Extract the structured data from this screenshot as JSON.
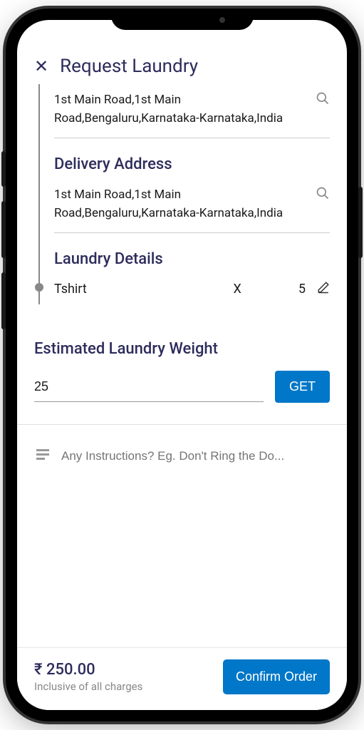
{
  "header": {
    "close": "✕",
    "title": "Request Laundry"
  },
  "pickup": {
    "address": "1st Main Road,1st Main Road,Bengaluru,Karnataka-Karnataka,India"
  },
  "delivery": {
    "title": "Delivery Address",
    "address": "1st Main Road,1st Main Road,Bengaluru,Karnataka-Karnataka,India"
  },
  "laundry": {
    "title": "Laundry Details",
    "item_name": "Tshirt",
    "item_x": "X",
    "item_qty": "5"
  },
  "weight": {
    "title": "Estimated Laundry Weight",
    "value": "25",
    "button": "GET"
  },
  "instructions": {
    "placeholder": "Any Instructions? Eg. Don't Ring the Do..."
  },
  "footer": {
    "price": "₹ 250.00",
    "sub": "Inclusive of all charges",
    "confirm": "Confirm Order"
  }
}
